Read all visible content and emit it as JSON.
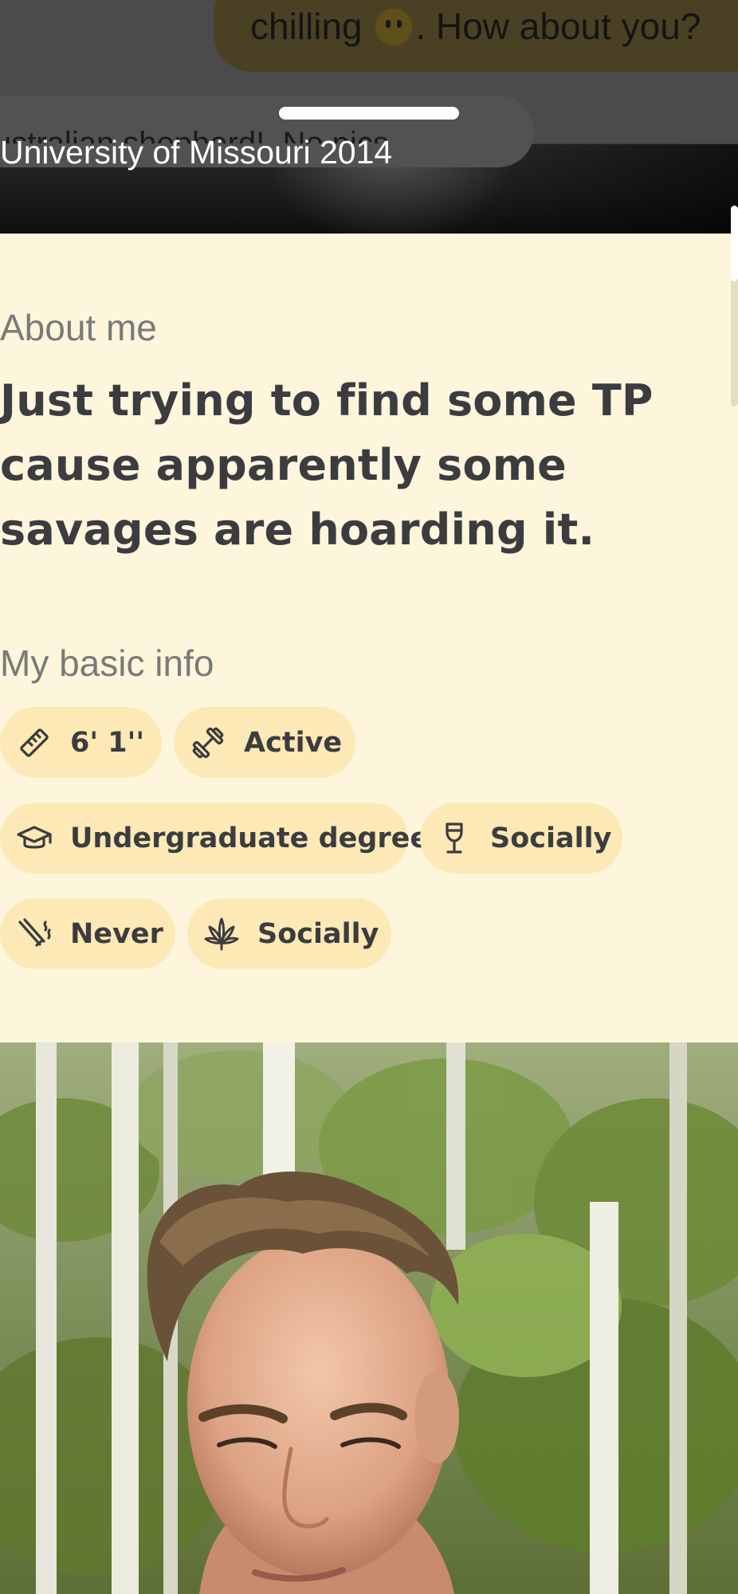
{
  "chat": {
    "message_prefix": "chilling",
    "message_suffix": ". How about you?",
    "previous_message": "ustralian shepherd!. No pics"
  },
  "profile": {
    "school_line": "University of Missouri 2014",
    "about": {
      "label": "About me",
      "text": "Just trying to find some TP cause apparently some savages are hoarding it."
    },
    "basic_info": {
      "label": "My basic info",
      "chips": [
        {
          "icon": "ruler-icon",
          "label": "6' 1''"
        },
        {
          "icon": "dumbbell-icon",
          "label": "Active"
        },
        {
          "icon": "graduation-cap-icon",
          "label": "Undergraduate degree"
        },
        {
          "icon": "wine-glass-icon",
          "label": "Socially"
        },
        {
          "icon": "cigarette-icon",
          "label": "Never"
        },
        {
          "icon": "cannabis-leaf-icon",
          "label": "Socially"
        }
      ]
    }
  },
  "colors": {
    "background": "#fdf6dc",
    "chip_background": "#fce9b6",
    "text_primary": "#3c3c40",
    "text_secondary": "#7a7a78"
  }
}
